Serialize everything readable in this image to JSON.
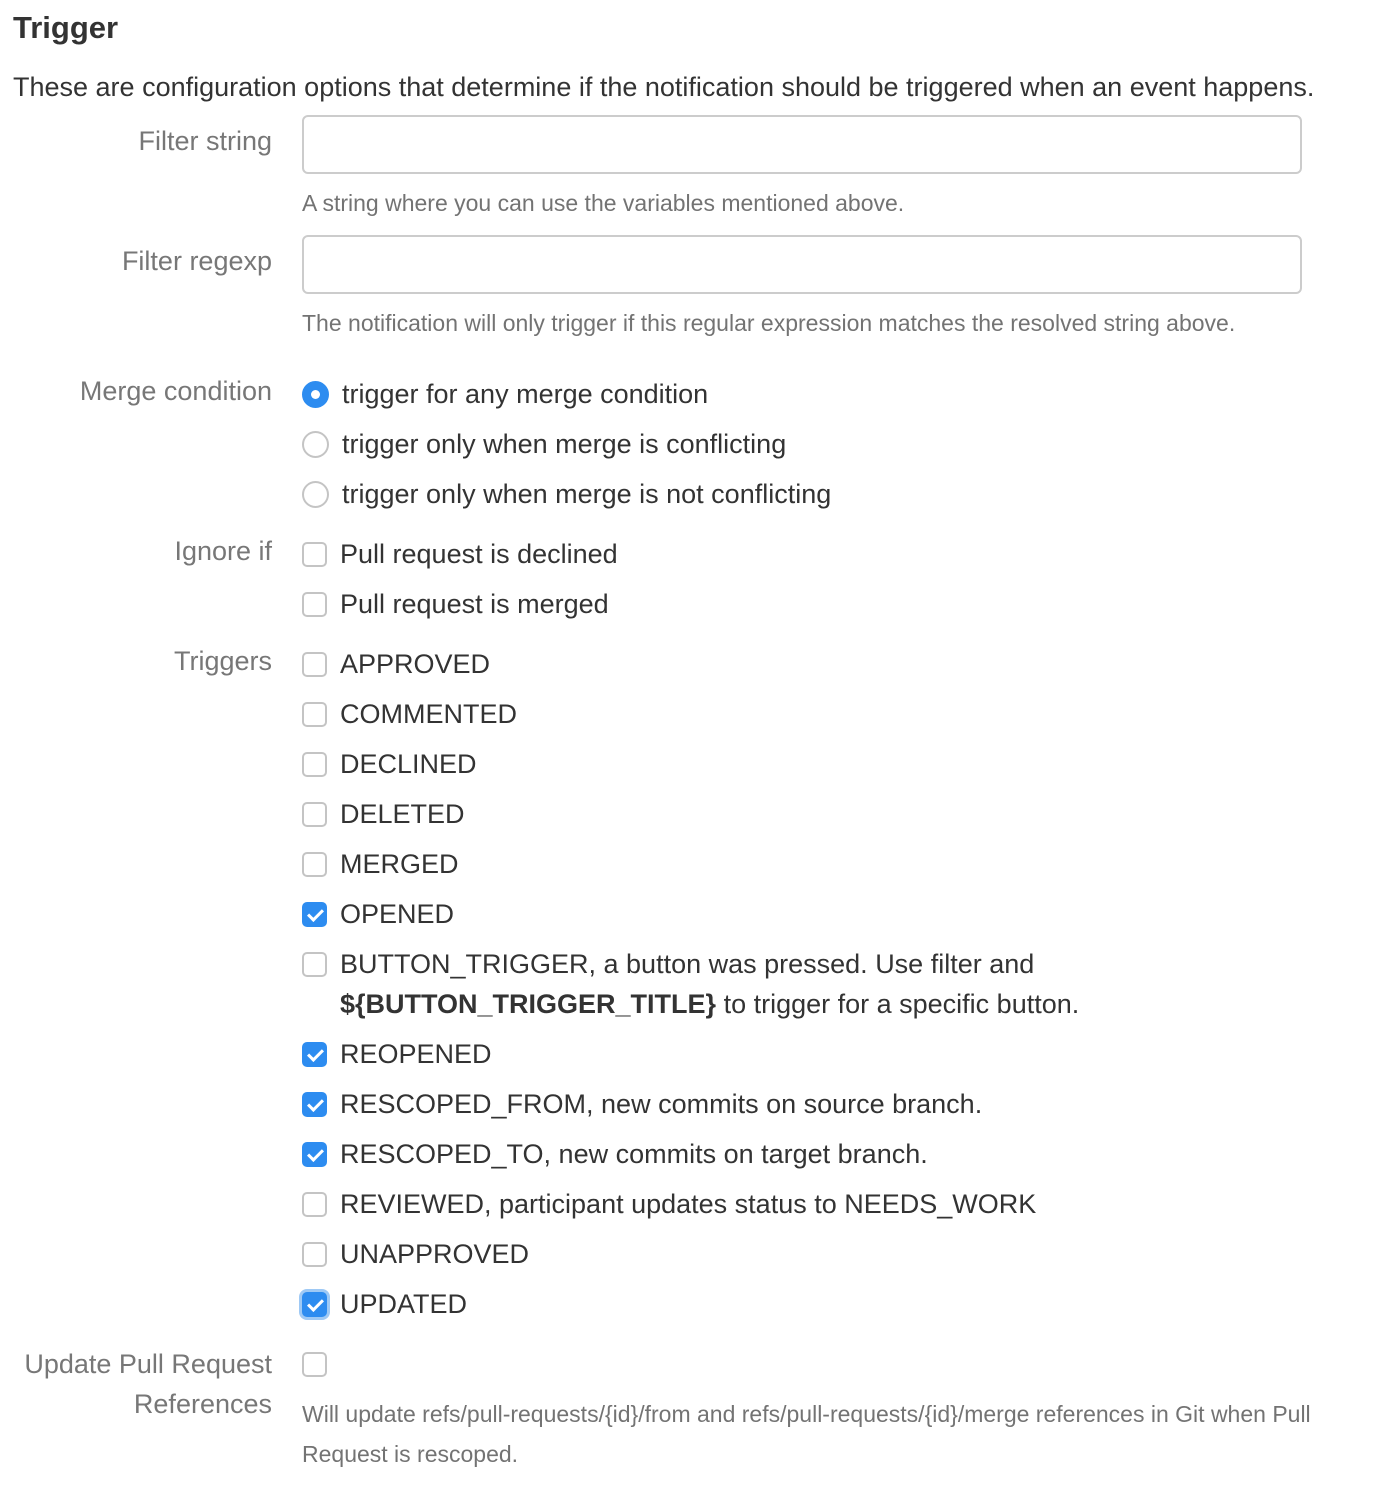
{
  "section": {
    "title": "Trigger",
    "description": "These are configuration options that determine if the notification should be triggered when an event happens."
  },
  "filter_string": {
    "label": "Filter string",
    "value": "",
    "help": "A string where you can use the variables mentioned above."
  },
  "filter_regexp": {
    "label": "Filter regexp",
    "value": "",
    "help": "The notification will only trigger if this regular expression matches the resolved string above."
  },
  "merge_condition": {
    "label": "Merge condition",
    "options": [
      {
        "label": "trigger for any merge condition",
        "selected": true
      },
      {
        "label": "trigger only when merge is conflicting",
        "selected": false
      },
      {
        "label": "trigger only when merge is not conflicting",
        "selected": false
      }
    ]
  },
  "ignore_if": {
    "label": "Ignore if",
    "options": [
      {
        "label": "Pull request is declined",
        "checked": false
      },
      {
        "label": "Pull request is merged",
        "checked": false
      }
    ]
  },
  "triggers": {
    "label": "Triggers",
    "options": [
      {
        "label": "APPROVED",
        "checked": false
      },
      {
        "label": "COMMENTED",
        "checked": false
      },
      {
        "label": "DECLINED",
        "checked": false
      },
      {
        "label": "DELETED",
        "checked": false
      },
      {
        "label": "MERGED",
        "checked": false
      },
      {
        "label": "OPENED",
        "checked": true
      },
      {
        "label": "BUTTON_TRIGGER, a button was pressed. Use filter and",
        "label_bold": "${BUTTON_TRIGGER_TITLE}",
        "label_after": " to trigger for a specific button.",
        "checked": false
      },
      {
        "label": "REOPENED",
        "checked": true
      },
      {
        "label": "RESCOPED_FROM, new commits on source branch.",
        "checked": true
      },
      {
        "label": "RESCOPED_TO, new commits on target branch.",
        "checked": true
      },
      {
        "label": "REVIEWED, participant updates status to NEEDS_WORK",
        "checked": false
      },
      {
        "label": "UNAPPROVED",
        "checked": false
      },
      {
        "label": "UPDATED",
        "checked": true
      }
    ]
  },
  "update_refs": {
    "label": "Update Pull Request References",
    "checked": false,
    "help": "Will update refs/pull-requests/{id}/from and refs/pull-requests/{id}/merge references in Git when Pull Request is rescoped."
  },
  "colors": {
    "accent": "#2d8cf0",
    "label": "#777777",
    "help": "#737373",
    "border": "#cccccc"
  }
}
